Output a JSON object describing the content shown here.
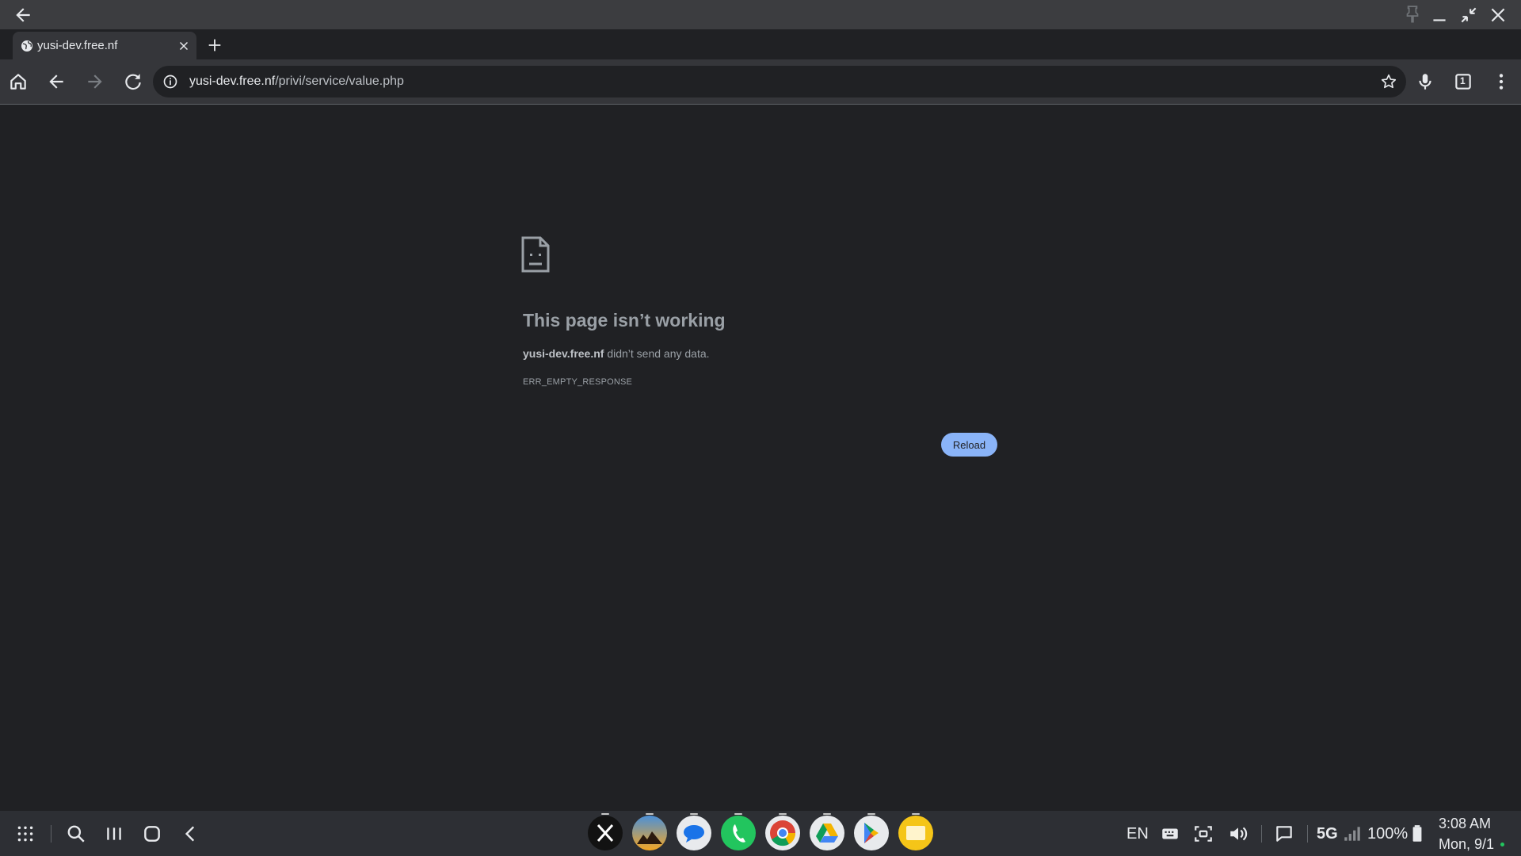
{
  "tab": {
    "title": "yusi-dev.free.nf"
  },
  "omnibox": {
    "url_host": "yusi-dev.free.nf",
    "url_path": "/privi/service/value.php"
  },
  "error": {
    "title": "This page isn’t working",
    "host": "yusi-dev.free.nf",
    "message": " didn’t send any data.",
    "code": "ERR_EMPTY_RESPONSE",
    "reload_label": "Reload"
  },
  "toolbar": {
    "tab_count": "1"
  },
  "shelf": {
    "apps": [
      "x-app",
      "gallery-app",
      "messages-app",
      "phone-app",
      "chrome-app",
      "drive-app",
      "play-store-app",
      "files-app"
    ],
    "lang": "EN",
    "network": "5G",
    "battery": "100%",
    "time": "3:08 AM",
    "date": "Mon, 9/1"
  },
  "colors": {
    "accent": "#8ab4f8",
    "background": "#202124",
    "toolbar": "#35363a"
  }
}
